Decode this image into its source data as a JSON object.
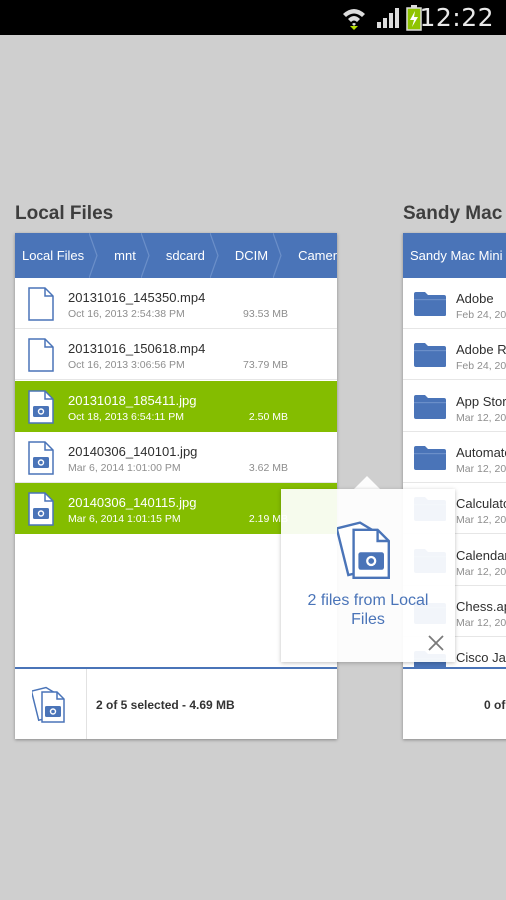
{
  "status_bar": {
    "time": "12:22",
    "icons": [
      "wifi-icon",
      "signal-icon",
      "battery-charging-icon"
    ]
  },
  "left_panel": {
    "title": "Local Files",
    "breadcrumb": [
      "Local Files",
      "mnt",
      "sdcard",
      "DCIM",
      "Camera"
    ],
    "files": [
      {
        "name": "20131016_145350.mp4",
        "date": "Oct 16, 2013 2:54:38 PM",
        "size": "93.53 MB",
        "icon": "file-icon",
        "selected": false
      },
      {
        "name": "20131016_150618.mp4",
        "date": "Oct 16, 2013 3:06:56 PM",
        "size": "73.79 MB",
        "icon": "file-icon",
        "selected": false
      },
      {
        "name": "20131018_185411.jpg",
        "date": "Oct 18, 2013 6:54:11 PM",
        "size": "2.50 MB",
        "icon": "photo-file-icon",
        "selected": true
      },
      {
        "name": "20140306_140101.jpg",
        "date": "Mar 6, 2014 1:01:00 PM",
        "size": "3.62 MB",
        "icon": "photo-file-icon",
        "selected": false
      },
      {
        "name": "20140306_140115.jpg",
        "date": "Mar 6, 2014 1:01:15 PM",
        "size": "2.19 MB",
        "icon": "photo-file-icon",
        "selected": true
      }
    ],
    "footer_text": "2 of 5 selected - 4.69 MB"
  },
  "right_panel": {
    "title": "Sandy Mac",
    "breadcrumb": [
      "Sandy Mac Mini"
    ],
    "folders": [
      {
        "name": "Adobe",
        "date": "Feb 24, 20"
      },
      {
        "name": "Adobe Re",
        "date": "Feb 24, 20"
      },
      {
        "name": "App Store",
        "date": "Mar 12, 20"
      },
      {
        "name": "Automato",
        "date": "Mar 12, 20"
      },
      {
        "name": "Calculato",
        "date": "Mar 12, 20"
      },
      {
        "name": "Calendar",
        "date": "Mar 12, 20"
      },
      {
        "name": "Chess.ap",
        "date": "Mar 12, 20"
      },
      {
        "name": "Cisco Jal",
        "date": ""
      }
    ],
    "footer_text": "0 of"
  },
  "drag_popup": {
    "text": "2 files from Local Files",
    "close_icon": "close-icon"
  },
  "colors": {
    "accent_blue": "#4a74b8",
    "selected_green": "#84bd00",
    "background": "#cfcfcf"
  }
}
